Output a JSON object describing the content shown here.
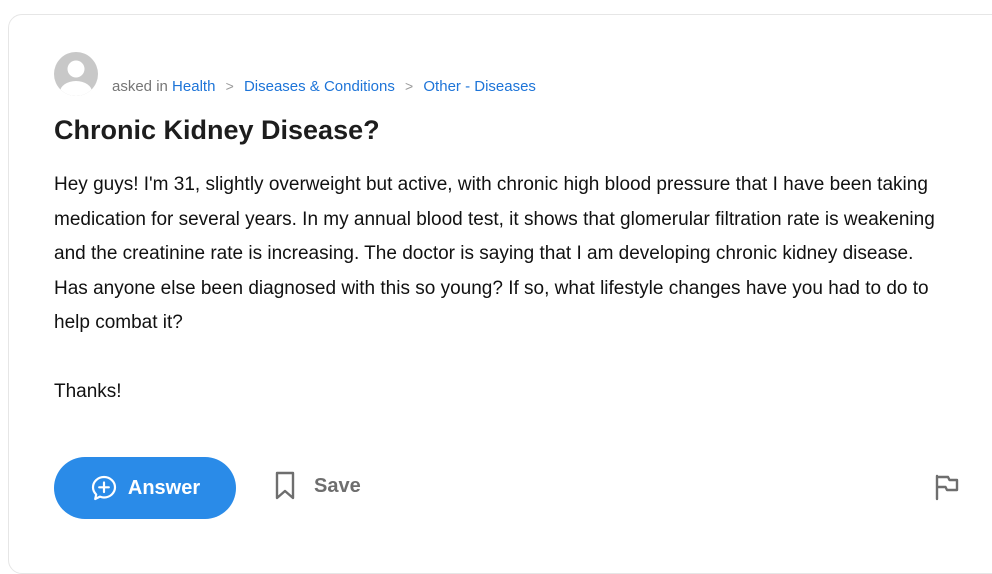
{
  "question": {
    "asked_in_label": "asked in",
    "breadcrumbs": [
      {
        "label": "Health"
      },
      {
        "label": "Diseases & Conditions"
      },
      {
        "label": "Other - Diseases"
      }
    ],
    "separator_glyph": ">",
    "title": "Chronic Kidney Disease?",
    "body_paragraphs": [
      "Hey guys!  I'm 31, slightly overweight but active, with chronic high blood pressure that I have been taking medication for several years.  In my annual blood test, it shows that glomerular filtration rate is weakening and the creatinine rate is increasing.  The doctor is saying that I am developing chronic kidney disease.",
      "Has anyone else been diagnosed with this so young?  If so, what lifestyle changes have you had to do to help combat it?",
      "",
      "Thanks!"
    ]
  },
  "actions": {
    "answer_label": "Answer",
    "save_label": "Save"
  },
  "icons": {
    "avatar": "default-user-avatar",
    "answer": "plus-in-speech-bubble-icon",
    "save": "bookmark-icon",
    "report": "flag-icon"
  },
  "colors": {
    "link": "#1d74d8",
    "primary_button": "#2a8be8",
    "muted_text": "#767676",
    "title_text": "#1d1d1d"
  }
}
